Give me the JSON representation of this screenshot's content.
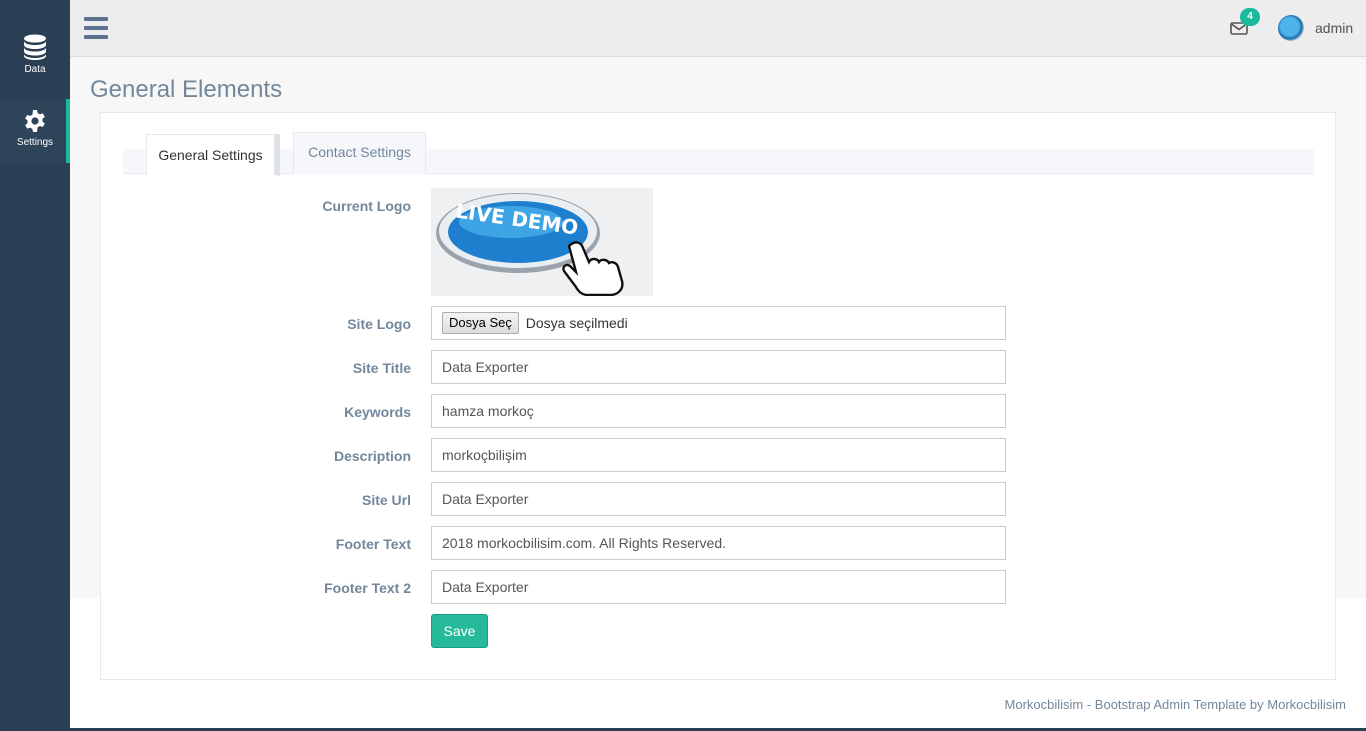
{
  "sidebar": {
    "items": [
      {
        "label": "Data",
        "icon": "database-icon"
      },
      {
        "label": "Settings",
        "icon": "gear-icon"
      }
    ]
  },
  "topnav": {
    "mail_count": "4",
    "user_name": "admin"
  },
  "page": {
    "title": "General Elements"
  },
  "tabs": [
    {
      "label": "General Settings",
      "active": true
    },
    {
      "label": "Contact Settings",
      "active": false
    }
  ],
  "form": {
    "current_logo_label": "Current Logo",
    "logo_image_text": "LIVE DEMO",
    "site_logo_label": "Site Logo",
    "file_button": "Dosya Seç",
    "file_status": "Dosya seçilmedi",
    "site_title_label": "Site Title",
    "site_title_value": "Data Exporter",
    "keywords_label": "Keywords",
    "keywords_value": "hamza morkoç",
    "description_label": "Description",
    "description_value": "morkoçbilişim",
    "site_url_label": "Site Url",
    "site_url_value": "Data Exporter",
    "footer_text_label": "Footer Text",
    "footer_text_value": "2018 morkocbilisim.com. All Rights Reserved.",
    "footer_text2_label": "Footer Text 2",
    "footer_text2_value": "Data Exporter",
    "save_label": "Save"
  },
  "footer": {
    "text": "Morkocbilisim - Bootstrap Admin Template by Morkocbilisim"
  },
  "colors": {
    "sidebar": "#2a3f54",
    "accent": "#1abb9c",
    "save_button": "#26b99a"
  }
}
